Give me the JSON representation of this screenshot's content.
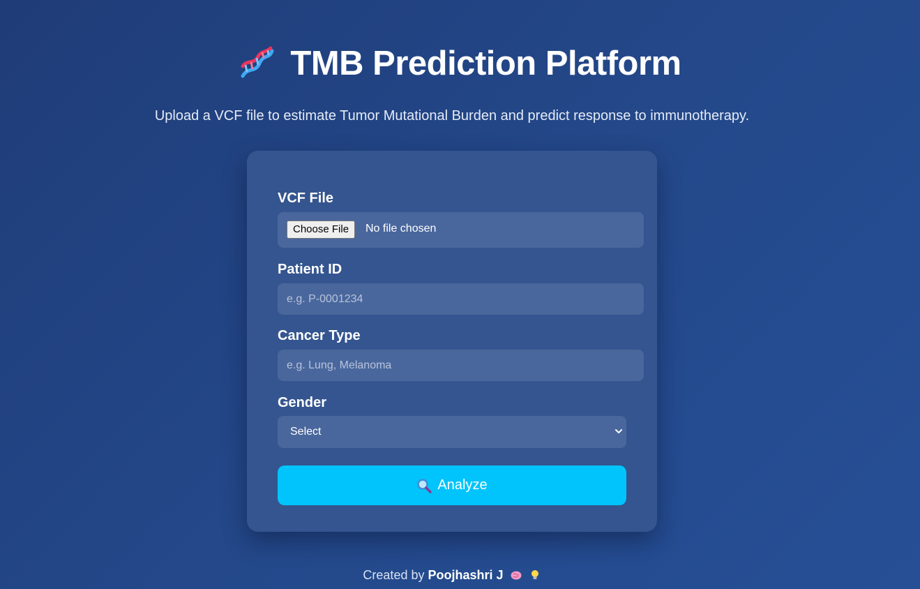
{
  "header": {
    "icon": "dna-icon",
    "title": "TMB Prediction Platform",
    "subtitle": "Upload a VCF file to estimate Tumor Mutational Burden and predict response to immunotherapy."
  },
  "form": {
    "vcf_label": "VCF File",
    "file_button": "Choose File",
    "file_status": "No file chosen",
    "patient_label": "Patient ID",
    "patient_placeholder": "e.g. P-0001234",
    "patient_value": "",
    "cancer_label": "Cancer Type",
    "cancer_placeholder": "e.g. Lung, Melanoma",
    "cancer_value": "",
    "gender_label": "Gender",
    "gender_selected": "Select",
    "analyze_label": "Analyze",
    "analyze_icon": "magnifier-icon"
  },
  "footer": {
    "prefix": "Created by",
    "author": "Poojhashri J",
    "icons": [
      "brain-icon",
      "lightbulb-icon"
    ]
  },
  "colors": {
    "background": "#24498b",
    "card": "#34558f",
    "field": "#4a679d",
    "accent": "#00c4fb"
  }
}
